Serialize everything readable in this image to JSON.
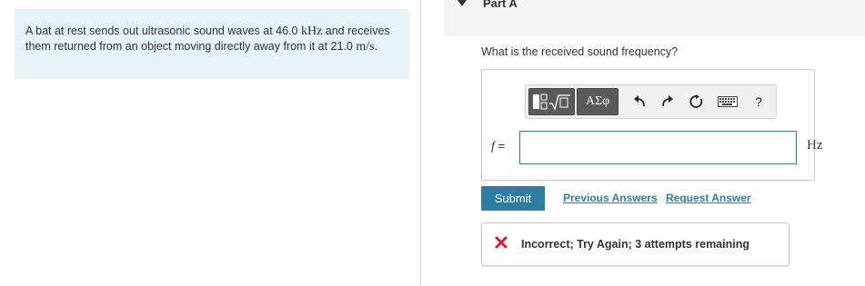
{
  "problem": {
    "text_before_freq": "A bat at rest sends out ultrasonic sound waves at 46.0 ",
    "freq_unit": "kHz",
    "text_after_freq": " and receives them returned from an object moving directly away from it at 21.0 ",
    "speed_unit": "m/s",
    "text_end": "."
  },
  "part": {
    "caret_icon": "triangle-down-icon",
    "title": "Part A"
  },
  "question": "What is the received sound frequency?",
  "toolbar": {
    "templates_icon": "templates-icon",
    "symbols_label": "ΑΣφ",
    "undo_icon": "undo-icon",
    "redo_icon": "redo-icon",
    "reset_icon": "reset-icon",
    "keyboard_icon": "keyboard-icon",
    "help_label": "?"
  },
  "answer": {
    "variable": "f",
    "equals": "=",
    "value": "",
    "unit": "Hz"
  },
  "actions": {
    "submit_label": "Submit",
    "previous_answers_label": "Previous Answers",
    "request_answer_label": "Request Answer"
  },
  "feedback": {
    "status_icon": "x-icon",
    "status_color": "#d0202e",
    "message": "Incorrect; Try Again; 3 attempts remaining"
  },
  "colors": {
    "accent": "#2b7ea1",
    "problem_bg": "#e6f4f7",
    "toolbar_button": "#5a5a5a"
  }
}
